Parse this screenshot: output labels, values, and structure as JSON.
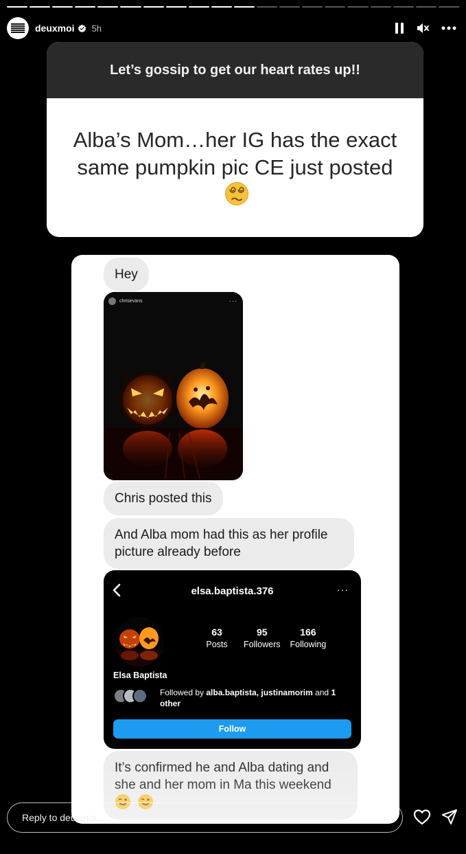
{
  "story": {
    "segments_total": 20,
    "segments_viewed": 11,
    "username": "deuxmoi",
    "time_ago": "5h"
  },
  "icons": {
    "verified": "verified-badge-icon",
    "pause": "pause-icon",
    "mute": "speaker-muted-icon",
    "more": "more-icon",
    "like": "heart-icon",
    "share": "send-icon"
  },
  "question_box": {
    "prompt": "Let’s gossip to get our heart rates up!!",
    "answer": "Alba’s Mom…her IG has the exact same pumpkin pic CE just posted"
  },
  "chat": {
    "message_1": "Hey",
    "post": {
      "username": "chrisevans",
      "more": "···"
    },
    "message_2": "Chris posted this",
    "message_3": "And Alba mom had this as her profile picture already before",
    "profile": {
      "handle": "elsa.baptista.376",
      "more": "···",
      "stats": [
        {
          "number": "63",
          "label": "Posts"
        },
        {
          "number": "95",
          "label": "Followers"
        },
        {
          "number": "166",
          "label": "Following"
        }
      ],
      "name": "Elsa Baptista",
      "followed_prefix": "Followed by ",
      "followed_names": "alba.baptista, justinamorim",
      "followed_and": " and ",
      "followed_other": "1 other",
      "follow_button": "Follow"
    },
    "message_4": "It’s confirmed he and Alba dating and she and her mom in Ma this weekend"
  },
  "reply": {
    "placeholder": "Reply to deuxmoi..."
  },
  "colors": {
    "follow_blue": "#1d9bf0",
    "bubble_gray": "#ebebeb",
    "question_header": "#2a2a2a"
  }
}
